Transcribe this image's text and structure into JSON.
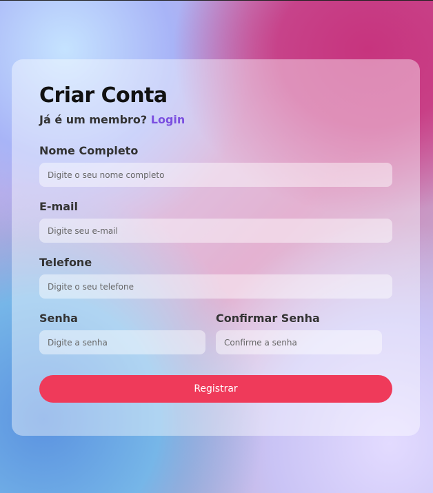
{
  "form": {
    "title": "Criar Conta",
    "member_prompt": "Já é um membro?",
    "login_link": "Login",
    "fields": {
      "full_name": {
        "label": "Nome Completo",
        "placeholder": "Digite o seu nome completo",
        "value": ""
      },
      "email": {
        "label": "E-mail",
        "placeholder": "Digite seu e-mail",
        "value": ""
      },
      "phone": {
        "label": "Telefone",
        "placeholder": "Digite o seu telefone",
        "value": ""
      },
      "password": {
        "label": "Senha",
        "placeholder": "Digite a senha",
        "value": ""
      },
      "confirm_password": {
        "label": "Confirmar Senha",
        "placeholder": "Confirme a senha",
        "value": ""
      }
    },
    "submit_label": "Registrar"
  },
  "colors": {
    "button": "#ef3a5a",
    "link": "#7b4fe0",
    "background_pink": "#c7347e",
    "background_blue": "#5b92e0"
  }
}
